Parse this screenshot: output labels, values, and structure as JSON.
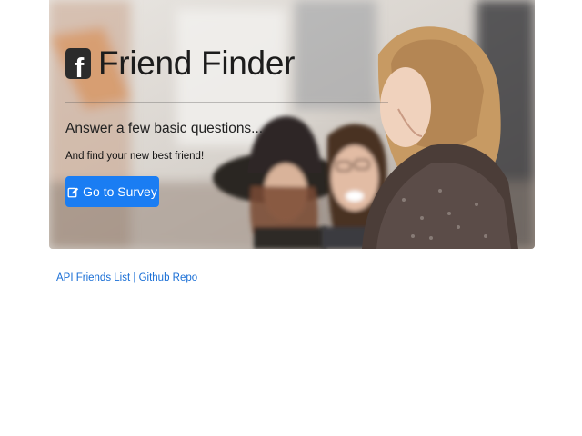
{
  "hero": {
    "brand_icon": "facebook-square-icon",
    "brand_glyph": "f",
    "title": "Friend Finder",
    "lead": "Answer a few basic questions...",
    "subtext": "And find your new best friend!",
    "survey_button": {
      "icon": "edit-icon",
      "label": "Go to Survey"
    }
  },
  "footer_links": {
    "api_label": "API Friends List",
    "separator": "|",
    "github_label": "Github Repo"
  },
  "colors": {
    "button": "#1a7df3",
    "link": "#1a6fd6",
    "title": "#1c1c1c"
  }
}
